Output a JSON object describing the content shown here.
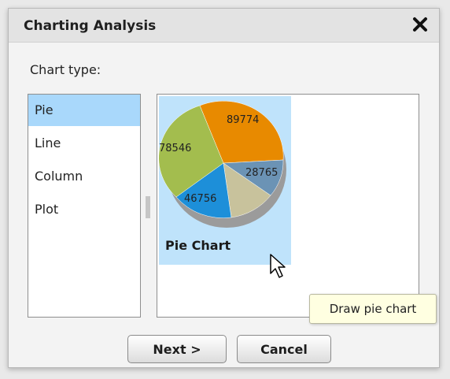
{
  "dialog": {
    "title": "Charting Analysis",
    "close_icon": "close-icon",
    "chart_type_label": "Chart type:",
    "chart_types": [
      {
        "label": "Pie",
        "selected": true
      },
      {
        "label": "Line",
        "selected": false
      },
      {
        "label": "Column",
        "selected": false
      },
      {
        "label": "Plot",
        "selected": false
      }
    ],
    "preview": {
      "tile_label": "Pie Chart",
      "tooltip": "Draw pie chart",
      "pie_values": [
        89774,
        28765,
        46756,
        78546
      ],
      "pie_labels": [
        "89774",
        "28765",
        "46756",
        "78546"
      ],
      "pie_colors": [
        "#e88a00",
        "#6b93b5",
        "#c8c29c",
        "#1d8fd9",
        "#a3bd4e"
      ]
    },
    "buttons": {
      "next_label": "Next >",
      "cancel_label": "Cancel"
    }
  }
}
